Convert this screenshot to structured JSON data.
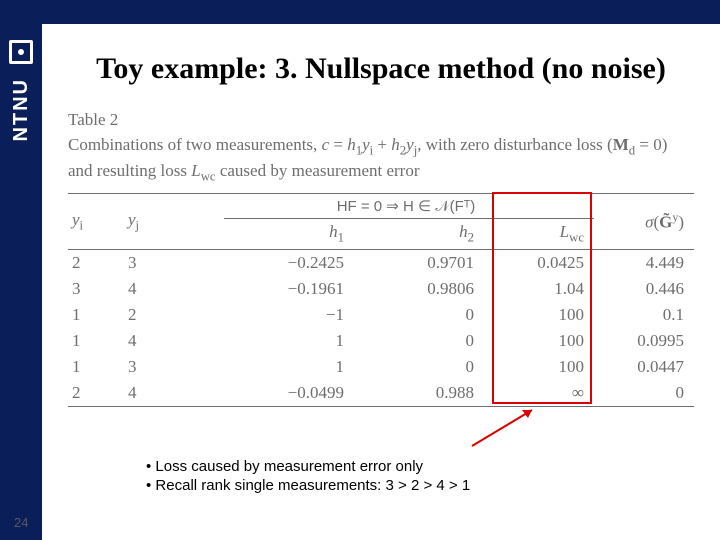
{
  "brand": {
    "name": "NTNU"
  },
  "slide": {
    "number": "24",
    "title": "Toy example: 3. Nullspace method (no noise)"
  },
  "table": {
    "label": "Table 2",
    "caption_html": "Combinations of two measurements, c = h₁yᵢ + h₂yⱼ, with zero disturbance loss (M_d = 0) and resulting loss L_wc caused by measurement error",
    "mid_header": "HF = 0  ⇒  H ∈ 𝒩(Fᵀ)",
    "cols": {
      "yi": "yᵢ",
      "yj": "yⱼ",
      "h1": "h₁",
      "h2": "h₂",
      "lwc": "L_wc",
      "sigma": "σ(G̃ʸ)"
    },
    "rows": [
      {
        "yi": "2",
        "yj": "3",
        "h1": "−0.2425",
        "h2": "0.9701",
        "lwc": "0.0425",
        "sigma": "4.449"
      },
      {
        "yi": "3",
        "yj": "4",
        "h1": "−0.1961",
        "h2": "0.9806",
        "lwc": "1.04",
        "sigma": "0.446"
      },
      {
        "yi": "1",
        "yj": "2",
        "h1": "−1",
        "h2": "0",
        "lwc": "100",
        "sigma": "0.1"
      },
      {
        "yi": "1",
        "yj": "4",
        "h1": "1",
        "h2": "0",
        "lwc": "100",
        "sigma": "0.0995"
      },
      {
        "yi": "1",
        "yj": "3",
        "h1": "1",
        "h2": "0",
        "lwc": "100",
        "sigma": "0.0447"
      },
      {
        "yi": "2",
        "yj": "4",
        "h1": "−0.0499",
        "h2": "0.988",
        "lwc": "∞",
        "sigma": "0"
      }
    ]
  },
  "notes": {
    "b1": "Loss caused by measurement error only",
    "b2": "Recall rank single measurements: 3 > 2 > 4 > 1"
  }
}
